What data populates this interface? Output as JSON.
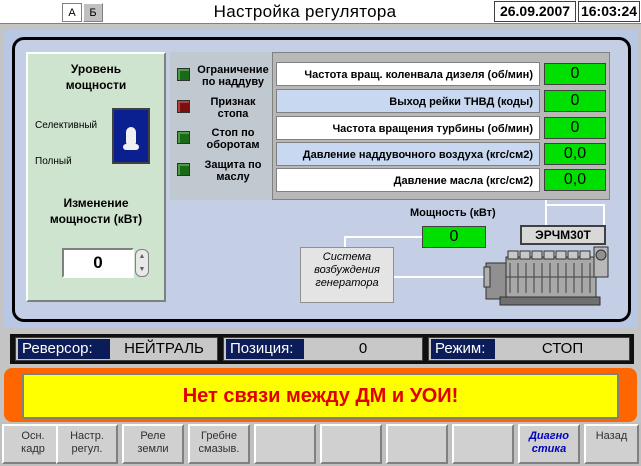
{
  "header": {
    "tab_a": "А",
    "tab_b": "Б",
    "title": "Настройка регулятора",
    "date": "26.09.2007",
    "time": "16:03:24"
  },
  "power_level": {
    "title_line1": "Уровень",
    "title_line2": "мощности",
    "option_selective": "Селективный",
    "option_full": "Полный",
    "change_line1": "Изменение",
    "change_line2": "мощности (кВт)",
    "change_value": "0"
  },
  "indicators": [
    {
      "line1": "Ограничение",
      "line2": "по наддуву",
      "state": "green"
    },
    {
      "line1": "Признак",
      "line2": "стопа",
      "state": "red"
    },
    {
      "line1": "Стоп по",
      "line2": "оборотам",
      "state": "green"
    },
    {
      "line1": "Защита по",
      "line2": "маслу",
      "state": "green"
    }
  ],
  "parameters": [
    {
      "label": "Частота вращ. коленвала дизеля (об/мин)",
      "value": "0"
    },
    {
      "label": "Выход рейки ТНВД (коды)",
      "value": "0"
    },
    {
      "label": "Частота вращения турбины  (об/мин)",
      "value": "0"
    },
    {
      "label": "Давление наддувочного воздуха (кгс/см2)",
      "value": "0,0"
    },
    {
      "label": "Давление масла (кгс/см2)",
      "value": "0,0"
    }
  ],
  "power": {
    "label": "Мощность (кВт)",
    "value": "0",
    "engine": "ЭРЧМ30Т"
  },
  "excitation": {
    "line1": "Система",
    "line2": "возбуждения",
    "line3": "генератора"
  },
  "status": {
    "reverser_label": "Реверсор:",
    "reverser_value": "НЕЙТРАЛЬ",
    "position_label": "Позиция:",
    "position_value": "0",
    "mode_label": "Режим:",
    "mode_value": "СТОП"
  },
  "alarm": {
    "text": "Нет связи между ДМ и УОИ!"
  },
  "fkeys": [
    {
      "line1": "Осн.",
      "line2": "кадр"
    },
    {
      "line1": "Настр.",
      "line2": "регул."
    },
    {
      "line1": "Реле",
      "line2": "земли"
    },
    {
      "line1": "Гребне",
      "line2": "смазыв."
    },
    {
      "line1": "",
      "line2": ""
    },
    {
      "line1": "",
      "line2": ""
    },
    {
      "line1": "",
      "line2": ""
    },
    {
      "line1": "",
      "line2": ""
    },
    {
      "line1": "Диагно",
      "line2": "стика"
    },
    {
      "line1": "Назад",
      "line2": ""
    }
  ],
  "colors": {
    "value_green": "#00e000",
    "alarm_red": "#e00000",
    "alarm_yellow": "#ffff00",
    "alarm_orange": "#ff6600",
    "status_label_blue": "#0c1c58"
  }
}
